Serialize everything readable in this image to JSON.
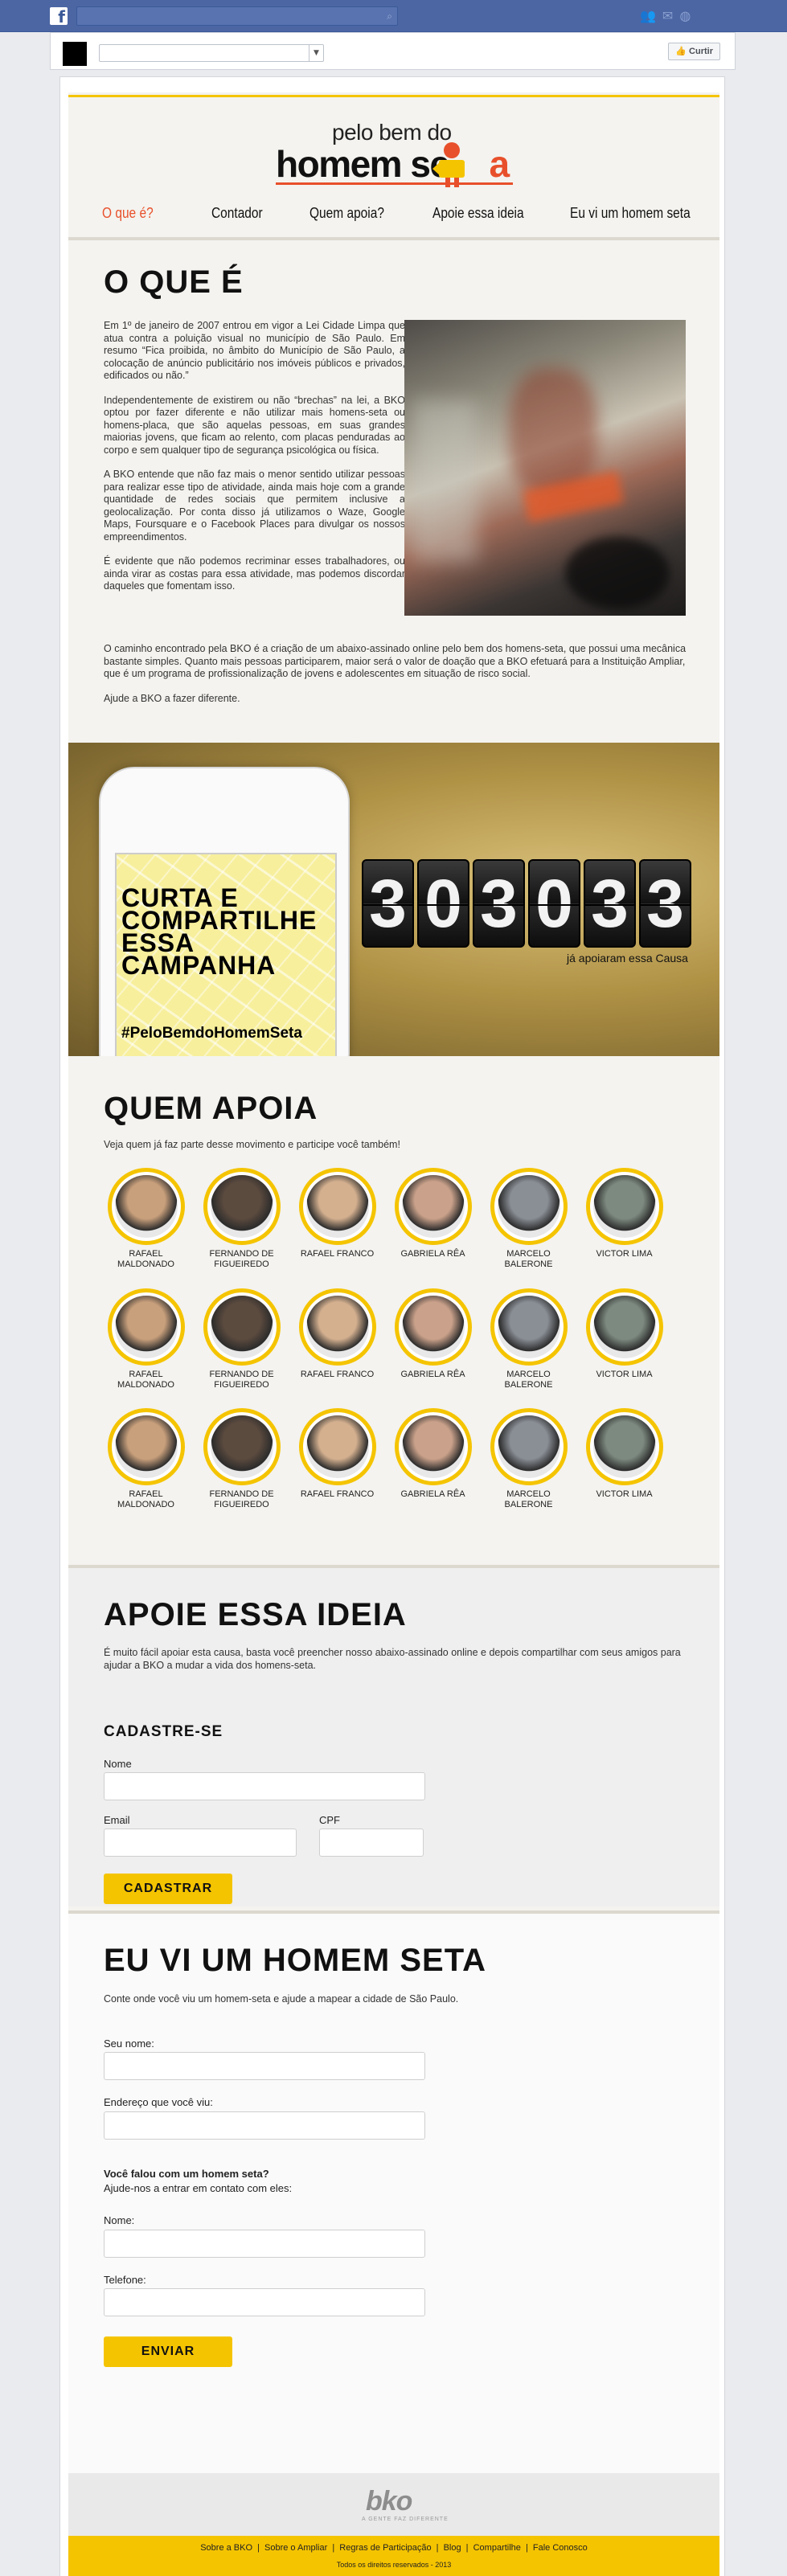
{
  "fb": {
    "logo": "f",
    "like_label": "Curtir"
  },
  "brand": {
    "line1": "pelo bem do",
    "line2": "homem se",
    "line2_end": "a"
  },
  "nav": [
    "O que é?",
    "Contador",
    "Quem apoia?",
    "Apoie essa ideia",
    "Eu vi um homem seta"
  ],
  "o_que_e": {
    "title": "O QUE É",
    "paragraphs": [
      "Em 1º de janeiro de 2007 entrou em vigor a Lei Cidade Limpa que atua contra a poluição visual no município de São Paulo. Em resumo “Fica proibida, no âmbito do Município de São Paulo, a colocação de anúncio publicitário nos imóveis públicos e privados, edificados ou não.”",
      "Independentemente de existirem ou não “brechas” na lei, a BKO optou por fazer diferente e não utilizar mais homens-seta ou homens-placa, que são aquelas pessoas, em suas grandes maiorias jovens, que ficam ao relento, com placas penduradas ao corpo e sem qualquer tipo de segurança psicológica ou física.",
      "A BKO entende que não faz mais o menor sentido utilizar pessoas para realizar esse tipo de atividade, ainda mais hoje com a grande quantidade de redes sociais que permitem inclusive a geolocalização. Por conta disso já utilizamos o Waze, Google Maps, Foursquare e o Facebook Places para divulgar os nossos empreendimentos.",
      "É evidente que não podemos recriminar esses trabalhadores, ou ainda virar as costas para essa atividade, mas podemos discordar daqueles que fomentam isso."
    ],
    "paragraphs_wide": [
      "O caminho encontrado pela BKO é a criação de um abaixo-assinado online pelo bem dos homens-seta, que possui uma mecânica bastante simples. Quanto mais pessoas participarem, maior será o valor de doação que a BKO efetuará para a Instituição Ampliar, que é um programa de profissionalização de jovens e adolescentes em situação de risco social.",
      "Ajude a BKO a fazer diferente."
    ]
  },
  "banner": {
    "cta": "CURTA E COMPARTILHE ESSA CAMPANHA",
    "hashtag": "#PeloBemdoHomemSeta",
    "digits": [
      "3",
      "0",
      "3",
      "0",
      "3",
      "3"
    ],
    "caption": "já apoiaram essa Causa"
  },
  "quem_apoia": {
    "title": "QUEM APOIA",
    "subtitle": "Veja quem já faz parte desse movimento e participe você também!",
    "people": [
      "RAFAEL MALDONADO",
      "FERNANDO DE FIGUEIREDO",
      "RAFAEL FRANCO",
      "GABRIELA RÊA",
      "MARCELO BALERONE",
      "VICTOR LIMA",
      "RAFAEL MALDONADO",
      "FERNANDO DE FIGUEIREDO",
      "RAFAEL FRANCO",
      "GABRIELA RÊA",
      "MARCELO BALERONE",
      "VICTOR LIMA",
      "RAFAEL MALDONADO",
      "FERNANDO DE FIGUEIREDO",
      "RAFAEL FRANCO",
      "GABRIELA RÊA",
      "MARCELO BALERONE",
      "VICTOR LIMA"
    ]
  },
  "apoie": {
    "title": "APOIE ESSA IDEIA",
    "text": "É muito fácil apoiar esta causa, basta você preencher nosso abaixo-assinado online e depois compartilhar com seus amigos para ajudar a BKO a mudar a vida dos homens-seta.",
    "form_title": "CADASTRE-SE",
    "label_nome": "Nome",
    "label_email": "Email",
    "label_cpf": "CPF",
    "button": "CADASTRAR"
  },
  "eu_vi": {
    "title": "EU VI UM HOMEM SETA",
    "text": "Conte onde você viu um homem-seta e ajude a mapear a cidade de São Paulo.",
    "label_nome": "Seu nome:",
    "label_endereco": "Endereço que você viu:",
    "question": "Você falou com um homem seta?",
    "question_sub": "Ajude-nos a entrar em contato com eles:",
    "label_nome2": "Nome:",
    "label_telefone": "Telefone:",
    "button": "ENVIAR"
  },
  "footer": {
    "logo": "bko",
    "logo_sub": "A GENTE FAZ DIFERENTE",
    "links": [
      "Sobre a BKO",
      "Sobre o Ampliar",
      "Regras de Participação",
      "Blog",
      "Compartilhe",
      "Fale Conosco"
    ],
    "copyright": "Todos os direitos reservados - 2013"
  },
  "colors": {
    "accent_yellow": "#f5c400",
    "accent_orange": "#e8502b",
    "fb_blue": "#4c66a4"
  }
}
